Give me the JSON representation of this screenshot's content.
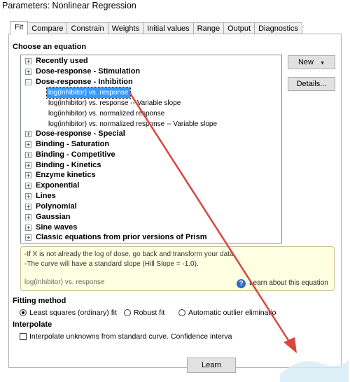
{
  "window": {
    "title": "Parameters: Nonlinear Regression"
  },
  "tabs": [
    "Fit",
    "Compare",
    "Constrain",
    "Weights",
    "Initial values",
    "Range",
    "Output",
    "Diagnostics"
  ],
  "choose_equation": {
    "label": "Choose an equation",
    "categories_top": [
      {
        "label": "Recently used",
        "expander": "+"
      },
      {
        "label": "Dose-response - Stimulation",
        "expander": "+"
      },
      {
        "label": "Dose-response - Inhibition",
        "expander": "-"
      }
    ],
    "inhibition_items": [
      "log(inhibitor) vs. response",
      "log(inhibitor) vs. response -- Variable slope",
      "log(inhibitor) vs. normalized response",
      "log(inhibitor) vs. normalized response -- Variable slope"
    ],
    "categories_bottom": [
      "Dose-response - Special",
      "Binding - Saturation",
      "Binding - Competitive",
      "Binding - Kinetics",
      "Enzyme kinetics",
      "Exponential",
      "Lines",
      "Polynomial",
      "Gaussian",
      "Sine waves",
      "Classic equations from prior versions of Prism"
    ],
    "new_button": "New",
    "details_button": "Details..."
  },
  "info": {
    "line1": "-If X is not already the log of dose, go back and transform your data",
    "line2": "-The curve will have a standard slope (Hill Slope = -1.0).",
    "equation_name": "log(inhibitor) vs. response",
    "learn_link": "Learn about this equation"
  },
  "fitting_method": {
    "label": "Fitting method",
    "options": [
      "Least squares (ordinary) fit",
      "Robust fit",
      "Automatic outlier eliminatio"
    ],
    "selected_index": 0
  },
  "interpolate": {
    "label": "Interpolate",
    "checkbox_label": "Interpolate unknowns from standard curve. Confidence interva",
    "checked": false
  },
  "bottom_button": "Learn"
}
